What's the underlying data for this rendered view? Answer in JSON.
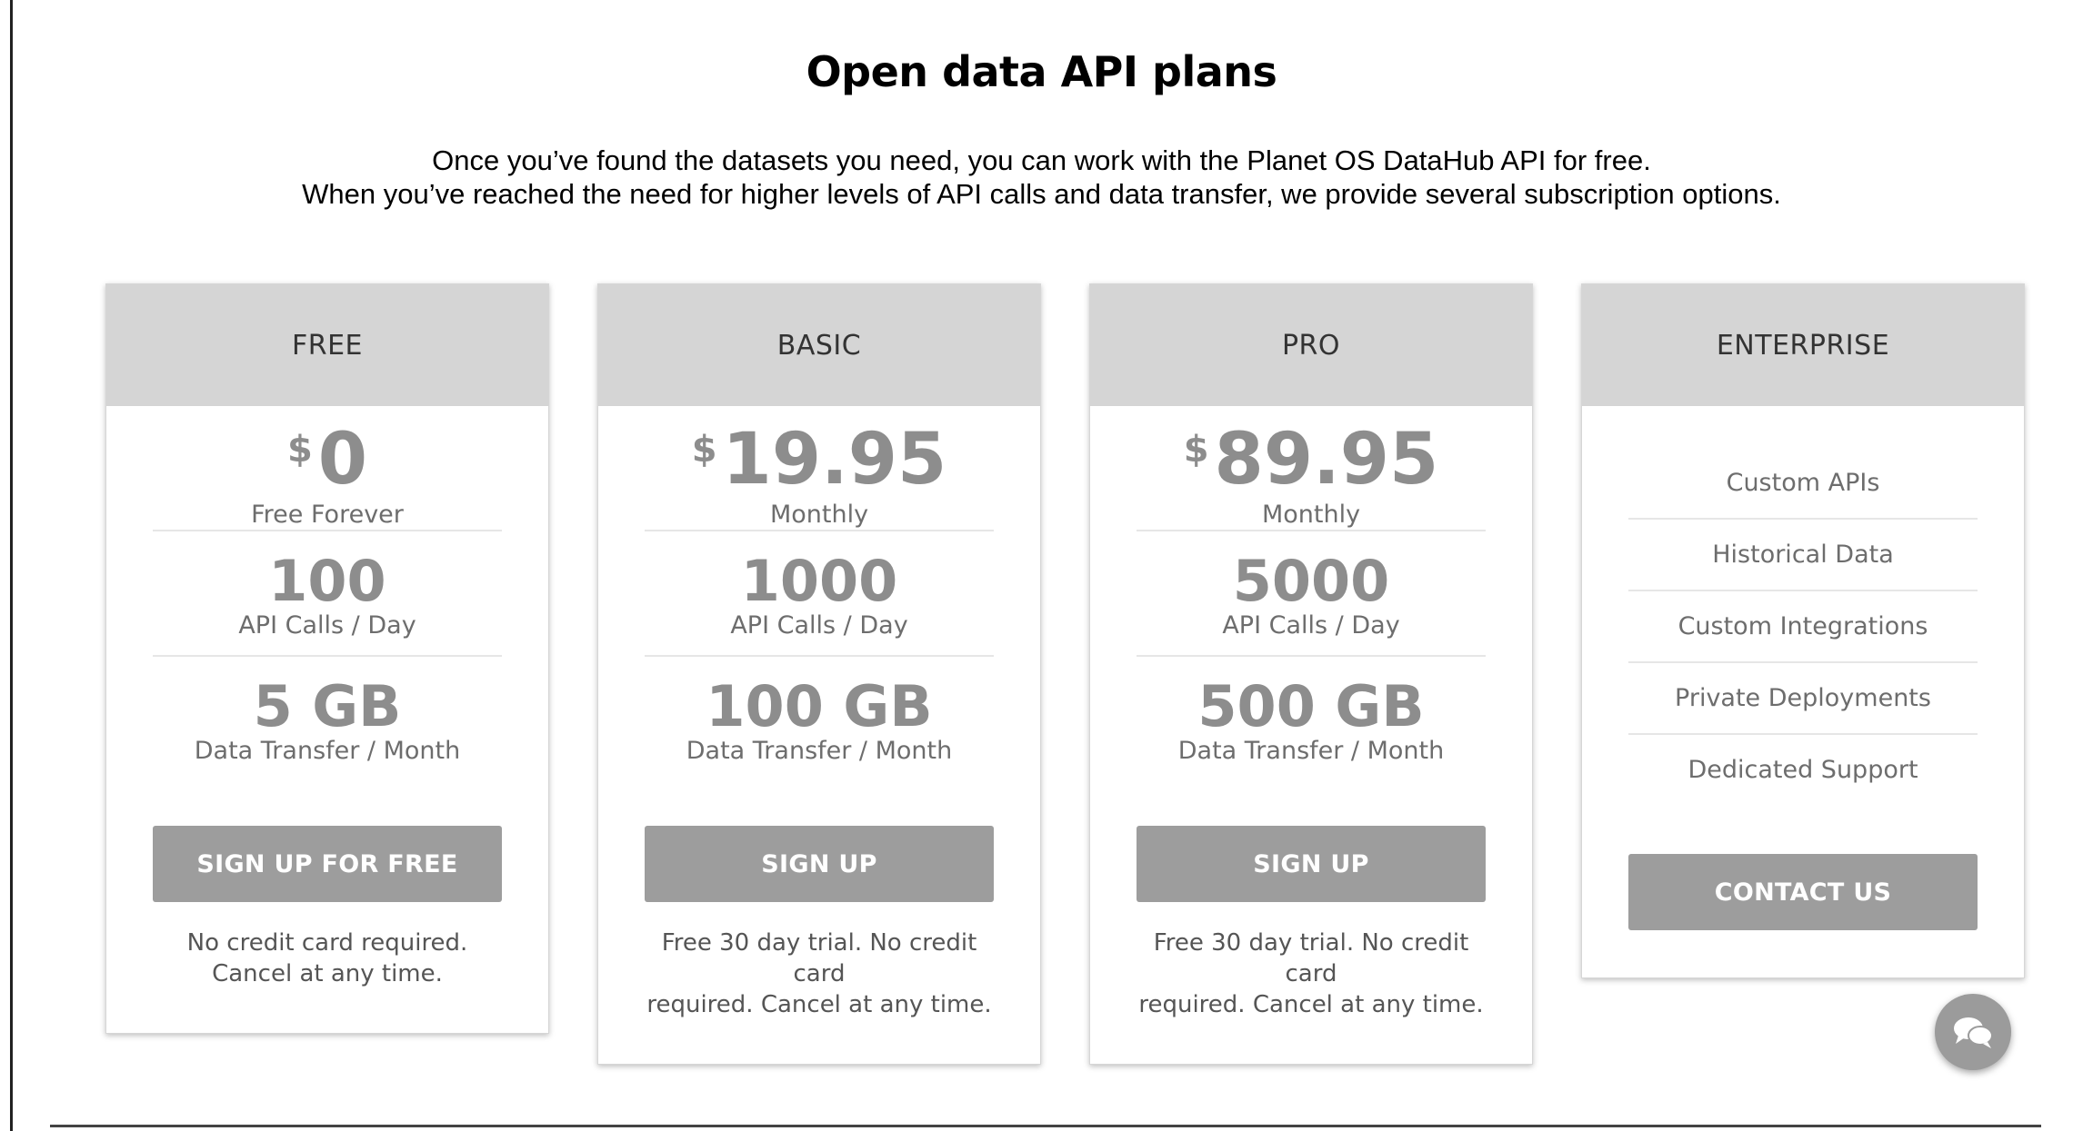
{
  "page": {
    "title": "Open data API plans",
    "intro_line1": "Once you’ve found the datasets you need, you can work with the Planet OS DataHub API for free.",
    "intro_line2": "When you’ve reached the need for higher levels of API calls and data transfer, we provide several subscription options."
  },
  "plans": [
    {
      "name": "FREE",
      "currency": "$",
      "price": "0",
      "period": "Free Forever",
      "calls": "100",
      "calls_label": "API Calls / Day",
      "transfer": "5 GB",
      "transfer_label": "Data Transfer / Month",
      "button": "SIGN UP FOR FREE",
      "note_line1": "No credit card required.",
      "note_line2": "Cancel at any time."
    },
    {
      "name": "BASIC",
      "currency": "$",
      "price": "19.95",
      "period": "Monthly",
      "calls": "1000",
      "calls_label": "API Calls / Day",
      "transfer": "100 GB",
      "transfer_label": "Data Transfer / Month",
      "button": "SIGN UP",
      "note_line1": "Free 30 day trial. No credit card",
      "note_line2": "required. Cancel at any time."
    },
    {
      "name": "PRO",
      "currency": "$",
      "price": "89.95",
      "period": "Monthly",
      "calls": "5000",
      "calls_label": "API Calls / Day",
      "transfer": "500 GB",
      "transfer_label": "Data Transfer / Month",
      "button": "SIGN UP",
      "note_line1": "Free 30 day trial. No credit card",
      "note_line2": "required. Cancel at any time."
    }
  ],
  "enterprise": {
    "name": "ENTERPRISE",
    "features": [
      "Custom APIs",
      "Historical Data",
      "Custom Integrations",
      "Private Deployments",
      "Dedicated Support"
    ],
    "button": "CONTACT US"
  },
  "chat": {
    "icon": "chat-bubbles-icon"
  },
  "colors": {
    "header_bg": "#d5d5d5",
    "button_bg": "#9d9d9d",
    "value_text": "#8d8d8d"
  }
}
